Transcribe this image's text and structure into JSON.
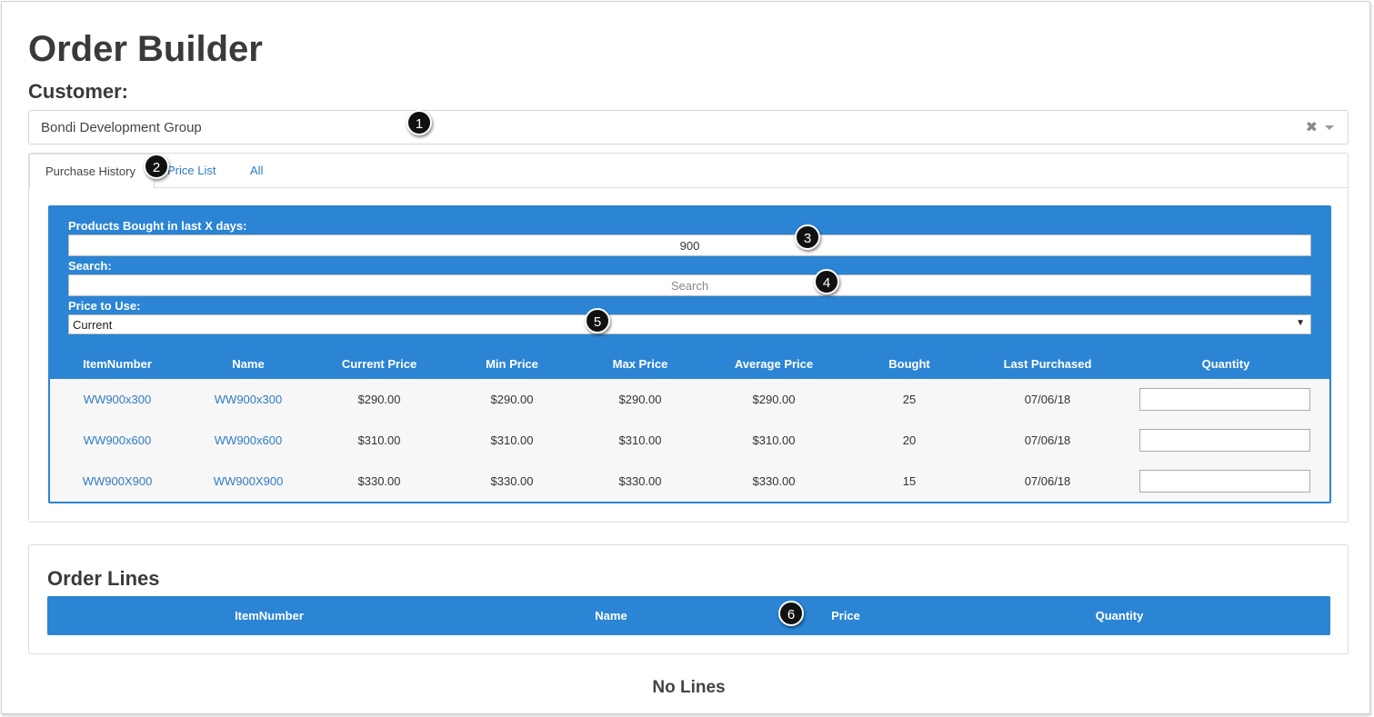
{
  "page": {
    "title": "Order Builder"
  },
  "customer": {
    "label": "Customer:",
    "value": "Bondi Development Group"
  },
  "tabs": [
    "Purchase History",
    "Price List",
    "All"
  ],
  "filters": {
    "days_label": "Products Bought in last X days:",
    "days_value": "900",
    "search_label": "Search:",
    "search_placeholder": "Search",
    "price_label": "Price to Use:",
    "price_value": "Current"
  },
  "products": {
    "columns": [
      "ItemNumber",
      "Name",
      "Current Price",
      "Min Price",
      "Max Price",
      "Average Price",
      "Bought",
      "Last Purchased",
      "Quantity"
    ],
    "rows": [
      {
        "item": "WW900x300",
        "name": "WW900x300",
        "current": "$290.00",
        "min": "$290.00",
        "max": "$290.00",
        "avg": "$290.00",
        "bought": "25",
        "last": "07/06/18"
      },
      {
        "item": "WW900x600",
        "name": "WW900x600",
        "current": "$310.00",
        "min": "$310.00",
        "max": "$310.00",
        "avg": "$310.00",
        "bought": "20",
        "last": "07/06/18"
      },
      {
        "item": "WW900X900",
        "name": "WW900X900",
        "current": "$330.00",
        "min": "$330.00",
        "max": "$330.00",
        "avg": "$330.00",
        "bought": "15",
        "last": "07/06/18"
      }
    ]
  },
  "order_lines": {
    "title": "Order Lines",
    "columns": [
      "ItemNumber",
      "Name",
      "Price",
      "Quantity"
    ],
    "empty_text": "No Lines"
  },
  "callouts": [
    "1",
    "2",
    "3",
    "4",
    "5",
    "6"
  ],
  "colors": {
    "accent": "#2b85d4",
    "link": "#2e7bc4"
  },
  "icons": {
    "clear": "clear-icon",
    "dropdown": "chevron-down-icon"
  }
}
